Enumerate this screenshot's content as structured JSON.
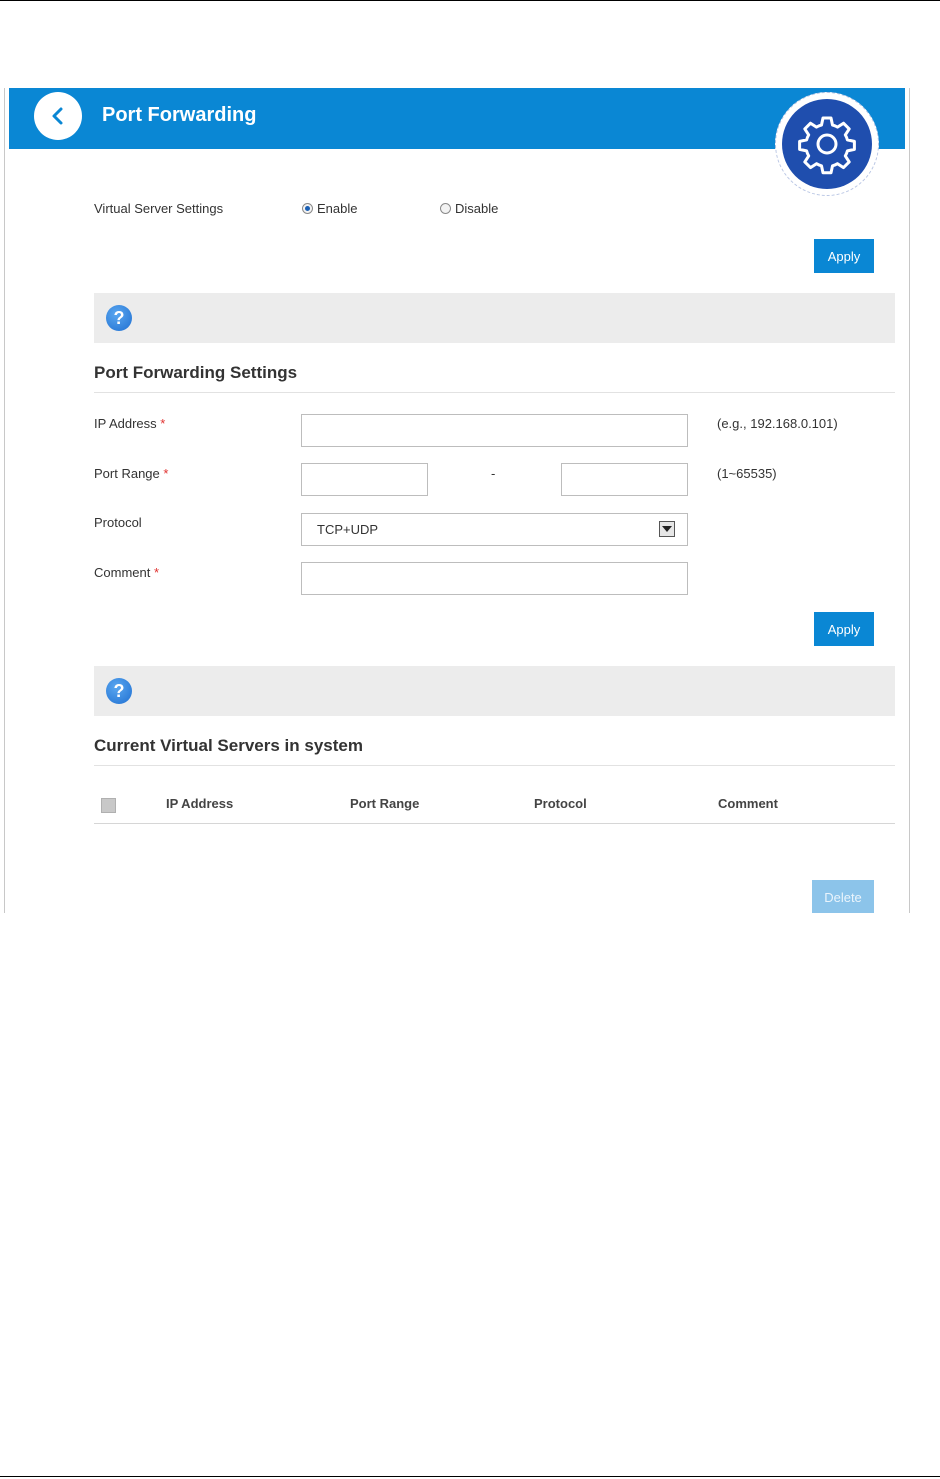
{
  "header": {
    "title": "Port Forwarding",
    "back_icon": "chevron-left-icon",
    "badge_icon": "gear-icon"
  },
  "virtual_server": {
    "label": "Virtual Server Settings",
    "enable_label": "Enable",
    "disable_label": "Disable",
    "selected": "Enable",
    "apply_label": "Apply"
  },
  "port_forwarding": {
    "section_title": "Port Forwarding Settings",
    "help_icon": "?",
    "ip_label": "IP Address",
    "ip_value": "",
    "ip_hint": "(e.g., 192.168.0.101)",
    "port_label": "Port Range",
    "port_start": "",
    "port_end": "",
    "port_separator": "-",
    "port_hint": "(1~65535)",
    "protocol_label": "Protocol",
    "protocol_value": "TCP+UDP",
    "comment_label": "Comment",
    "comment_value": "",
    "required_mark": "*",
    "apply_label": "Apply"
  },
  "current_servers": {
    "section_title": "Current Virtual Servers in system",
    "help_icon": "?",
    "columns": [
      "IP Address",
      "Port Range",
      "Protocol",
      "Comment"
    ],
    "rows": [],
    "delete_label": "Delete"
  },
  "colors": {
    "header": "#0a87d4",
    "badge": "#1f4eae",
    "required": "#e0312f"
  }
}
